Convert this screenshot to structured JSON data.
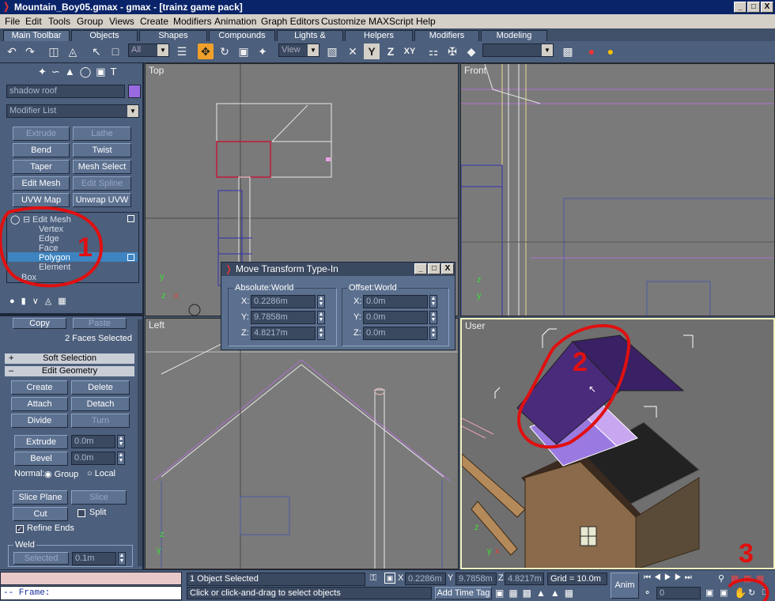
{
  "titlebar": {
    "title": "Mountain_Boy05.gmax - gmax - [trainz game pack]",
    "minimize": "_",
    "maximize": "□",
    "close": "X"
  },
  "menubar": {
    "items": [
      "File",
      "Edit",
      "Tools",
      "Group",
      "Views",
      "Create",
      "Modifiers",
      "Animation",
      "Graph Editors",
      "Customize",
      "MAXScript",
      "Help"
    ]
  },
  "tabs": [
    "Main Toolbar",
    "Objects",
    "Shapes",
    "Compounds",
    "Lights & Cameras",
    "Helpers",
    "Modifiers",
    "Modeling"
  ],
  "toolbar": {
    "selection_filter": "All",
    "ref_coord": "View",
    "named_selection": "",
    "axis_y": "Y",
    "axis_z": "Z",
    "axis_xy": "XY"
  },
  "panel": {
    "object_name": "shadow roof",
    "modifier_list": "Modifier List",
    "modifier_buttons": [
      "Extrude",
      "Lathe",
      "Bend",
      "Twist",
      "Taper",
      "Mesh Select",
      "Edit Mesh",
      "Edit Spline",
      "UVW Map",
      "Unwrap UVW"
    ],
    "stack": {
      "root": "Edit Mesh",
      "children": [
        "Vertex",
        "Edge",
        "Face",
        "Polygon",
        "Element"
      ],
      "selected": "Polygon",
      "base": "Box"
    },
    "copy": "Copy",
    "paste": "Paste",
    "faces_selected": "2 Faces Selected",
    "soft_selection": "Soft Selection",
    "edit_geometry": "Edit Geometry",
    "geom_buttons": [
      "Create",
      "Delete",
      "Attach",
      "Detach",
      "Divide",
      "Turn"
    ],
    "extrude": {
      "label": "Extrude",
      "value": "0.0m"
    },
    "bevel": {
      "label": "Bevel",
      "value": "0.0m"
    },
    "normal": {
      "label": "Normal:",
      "group": "Group",
      "local": "Local"
    },
    "slice_plane": "Slice Plane",
    "slice": "Slice",
    "cut": "Cut",
    "split": "Split",
    "refine_ends": "Refine Ends",
    "weld": {
      "title": "Weld",
      "selected": "Selected",
      "value": "0.1m"
    }
  },
  "viewports": {
    "top": "Top",
    "front": "Front",
    "left": "Left",
    "user": "User"
  },
  "dialog": {
    "title": "Move Transform Type-In",
    "absolute": {
      "title": "Absolute:World",
      "x": "0.2286m",
      "y": "9.7858m",
      "z": "4.8217m"
    },
    "offset": {
      "title": "Offset:World",
      "x": "0.0m",
      "y": "0.0m",
      "z": "0.0m"
    },
    "axis_labels": [
      "X:",
      "Y:",
      "Z:"
    ]
  },
  "status": {
    "frame_label": "-- Frame:",
    "selection": "1 Object Selected",
    "prompt": "Click or click-and-drag to select objects",
    "x": "0.2286m",
    "y": "9.7858m",
    "z": "4.8217m",
    "grid": "Grid = 10.0m",
    "add_time_tag": "Add Time Tag",
    "anim": "Anim",
    "frame_value": "0"
  },
  "annotations": [
    "1",
    "2",
    "3"
  ],
  "colors": {
    "accent": "#f0a02a",
    "annotation": "#e01010",
    "selected_poly": "#4a2a7a"
  }
}
